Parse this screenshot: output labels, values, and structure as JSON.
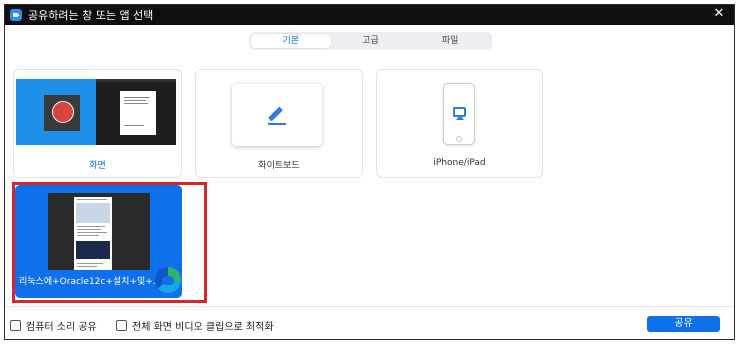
{
  "window": {
    "title": "공유하려는 창 또는 앱 선택",
    "close_symbol": "✕"
  },
  "tabs": [
    {
      "label": "기본",
      "active": true
    },
    {
      "label": "고급",
      "active": false
    },
    {
      "label": "파일",
      "active": false
    }
  ],
  "sources": {
    "screen": {
      "label": "화면",
      "selected": false
    },
    "whiteboard": {
      "label": "화이트보드",
      "icon": "pen-icon"
    },
    "iphone": {
      "label": "iPhone/iPad",
      "icon": "airplay-icon"
    },
    "browser_window": {
      "label": "리눅스에+Oracle12c+설치+및+...",
      "icon": "edge-icon",
      "selected": true
    }
  },
  "footer": {
    "share_audio_label": "컴퓨터 소리 공유",
    "share_audio_checked": false,
    "optimize_video_label": "전체 화면 비디오 클립으로 최적화",
    "optimize_video_checked": false,
    "share_button": "공유"
  },
  "colors": {
    "accent": "#0e71eb",
    "selection_outline": "#d9252a",
    "titlebar": "#0f0f0f"
  }
}
